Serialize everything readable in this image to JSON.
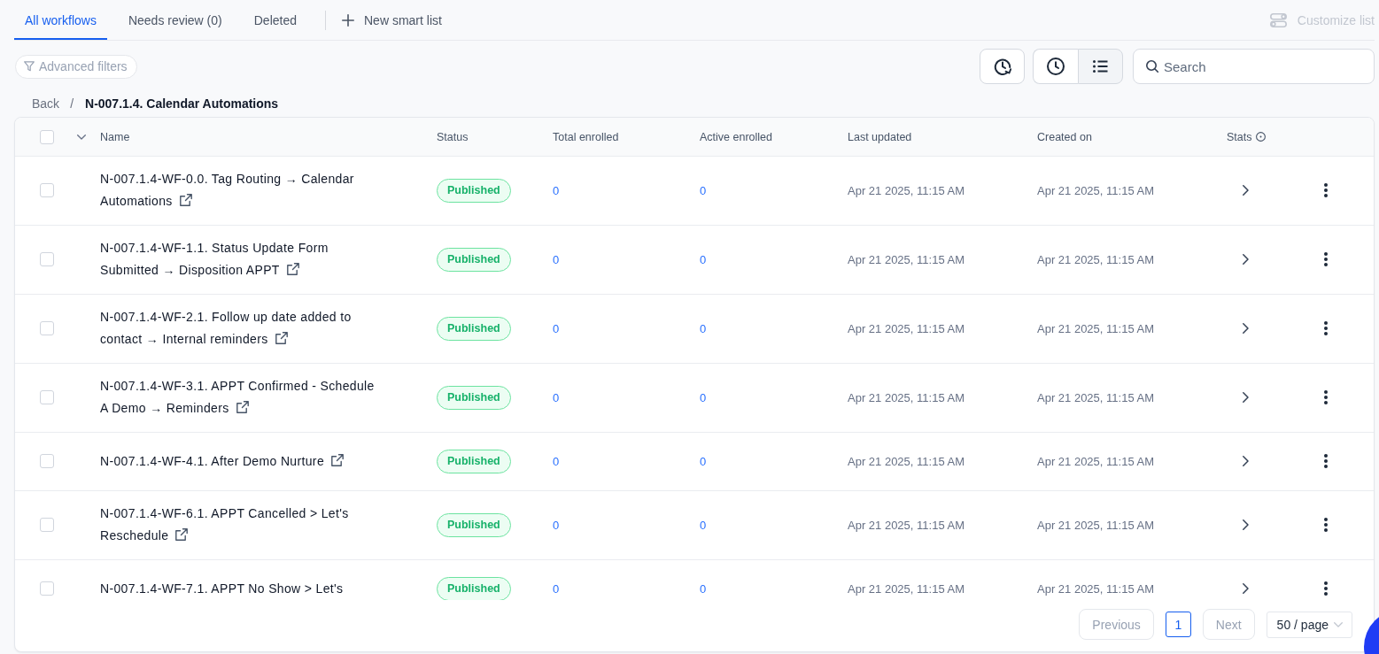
{
  "tabs": [
    {
      "label": "All workflows",
      "selected": true
    },
    {
      "label": "Needs review (0)",
      "selected": false
    },
    {
      "label": "Deleted",
      "selected": false
    }
  ],
  "new_smart_list": {
    "label": "New smart list"
  },
  "customize_list": {
    "label": "Customize list",
    "disabled": true
  },
  "advanced_filters": {
    "label": "Advanced filters"
  },
  "view_buttons": [
    {
      "kind": "clock",
      "selected": false
    },
    {
      "kind": "list",
      "selected": true
    }
  ],
  "search": {
    "placeholder": "Search"
  },
  "breadcrumb": {
    "back": "Back",
    "separator": "/",
    "current": "N-007.1.4. Calendar Automations"
  },
  "table": {
    "select_all": {
      "checked": false
    },
    "columns": [
      {
        "label": "Name",
        "info_icon": false
      },
      {
        "label": "Status",
        "info_icon": false
      },
      {
        "label": "Total enrolled",
        "info_icon": false
      },
      {
        "label": "Active enrolled",
        "info_icon": false
      },
      {
        "label": "Last updated",
        "info_icon": false
      },
      {
        "label": "Created on",
        "info_icon": false
      },
      {
        "label": "Stats",
        "info_icon": true
      }
    ],
    "rows": [
      {
        "checked": false,
        "name": "N-007.1.4-WF-0.0. Tag Routing → Calendar Automations",
        "link_icon": true,
        "status": "Published",
        "total_enrolled": "0",
        "active_enrolled": "0",
        "last_updated": "Apr 21 2025, 11:15 AM",
        "created_on": "Apr 21 2025, 11:15 AM"
      },
      {
        "checked": false,
        "name": "N-007.1.4-WF-1.1. Status Update Form Submitted → Disposition APPT",
        "link_icon": true,
        "status": "Published",
        "total_enrolled": "0",
        "active_enrolled": "0",
        "last_updated": "Apr 21 2025, 11:15 AM",
        "created_on": "Apr 21 2025, 11:15 AM"
      },
      {
        "checked": false,
        "name": "N-007.1.4-WF-2.1. Follow up date added to contact → Internal reminders",
        "link_icon": true,
        "status": "Published",
        "total_enrolled": "0",
        "active_enrolled": "0",
        "last_updated": "Apr 21 2025, 11:15 AM",
        "created_on": "Apr 21 2025, 11:15 AM"
      },
      {
        "checked": false,
        "name": "N-007.1.4-WF-3.1. APPT Confirmed - Schedule A Demo → Reminders",
        "link_icon": true,
        "status": "Published",
        "total_enrolled": "0",
        "active_enrolled": "0",
        "last_updated": "Apr 21 2025, 11:15 AM",
        "created_on": "Apr 21 2025, 11:15 AM"
      },
      {
        "checked": false,
        "name": "N-007.1.4-WF-4.1. After Demo Nurture",
        "link_icon": true,
        "status": "Published",
        "total_enrolled": "0",
        "active_enrolled": "0",
        "last_updated": "Apr 21 2025, 11:15 AM",
        "created_on": "Apr 21 2025, 11:15 AM"
      },
      {
        "checked": false,
        "name": "N-007.1.4-WF-6.1. APPT Cancelled > Let's Reschedule",
        "link_icon": true,
        "status": "Published",
        "total_enrolled": "0",
        "active_enrolled": "0",
        "last_updated": "Apr 21 2025, 11:15 AM",
        "created_on": "Apr 21 2025, 11:15 AM"
      },
      {
        "checked": false,
        "name": "N-007.1.4-WF-7.1. APPT No Show > Let's",
        "link_icon": false,
        "status": "Published",
        "total_enrolled": "0",
        "active_enrolled": "0",
        "last_updated": "Apr 21 2025, 11:15 AM",
        "created_on": "Apr 21 2025, 11:15 AM"
      }
    ]
  },
  "pagination": {
    "previous": {
      "label": "Previous",
      "disabled": true
    },
    "pages": [
      {
        "label": "1",
        "selected": true
      }
    ],
    "next": {
      "label": "Next",
      "disabled": true
    },
    "page_size": "50 / page"
  }
}
